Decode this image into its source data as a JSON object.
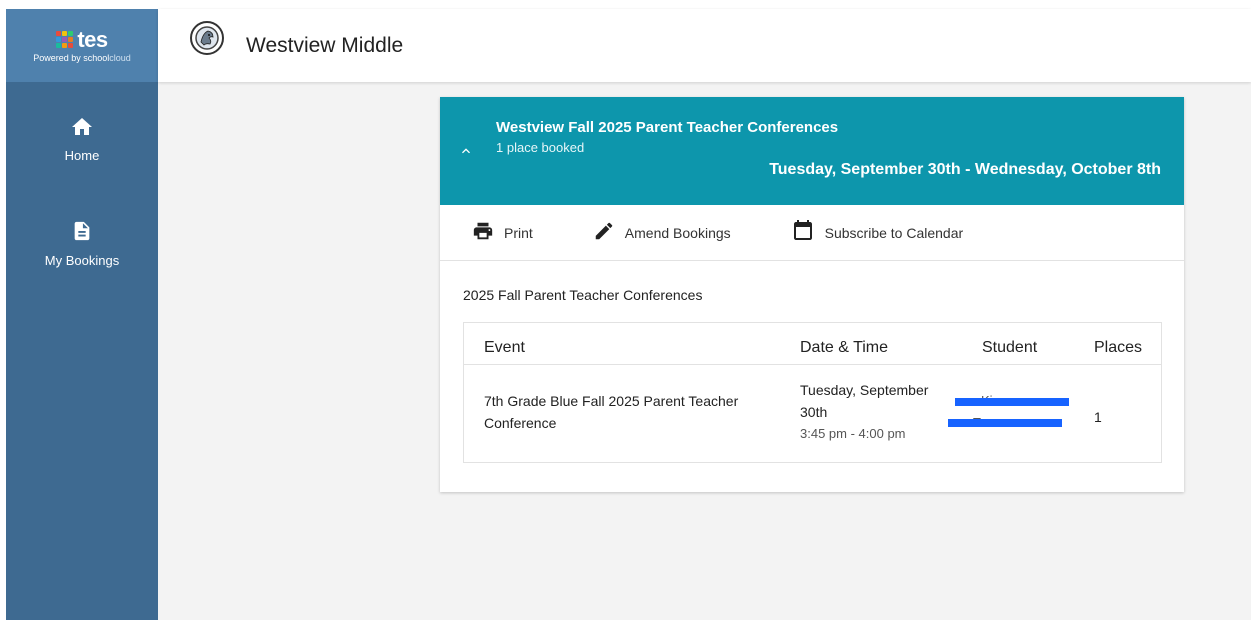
{
  "brand": {
    "name": "tes",
    "powered_prefix": "Powered by school",
    "powered_suffix": "cloud",
    "dot_colors": [
      "#e84c3d",
      "#f1c40f",
      "#2ecc71",
      "#3498db",
      "#9b59b6",
      "#e67e22",
      "#1abc9c",
      "#f39c12",
      "#e74c3c"
    ]
  },
  "sidebar": {
    "items": [
      {
        "label": "Home",
        "icon": "home-icon"
      },
      {
        "label": "My Bookings",
        "icon": "document-icon"
      }
    ]
  },
  "header": {
    "school_name": "Westview Middle",
    "logo_icon": "school-crest-icon"
  },
  "event": {
    "title": "Westview Fall 2025 Parent Teacher Conferences",
    "subtitle": "1 place booked",
    "date_range": "Tuesday, September 30th - Wednesday, October 8th",
    "header_color": "#0d96ac"
  },
  "toolbar": {
    "print_label": "Print",
    "amend_label": "Amend Bookings",
    "subscribe_label": "Subscribe to Calendar"
  },
  "section": {
    "title": "2025 Fall Parent Teacher Conferences"
  },
  "table": {
    "headers": {
      "event": "Event",
      "datetime": "Date & Time",
      "student": "Student",
      "places": "Places"
    },
    "rows": [
      {
        "event": "7th Grade Blue Fall 2025 Parent Teacher Conference",
        "date_line1": "Tuesday, September",
        "date_line2": "30th",
        "time": "3:45 pm - 4:00 pm",
        "student_line1": "Kiara",
        "student_line2": "Turner",
        "places": "1"
      }
    ]
  },
  "colors": {
    "sidebar": "#3e6a91",
    "brand_bg": "#4f81ad",
    "redaction": "#1763ff"
  }
}
